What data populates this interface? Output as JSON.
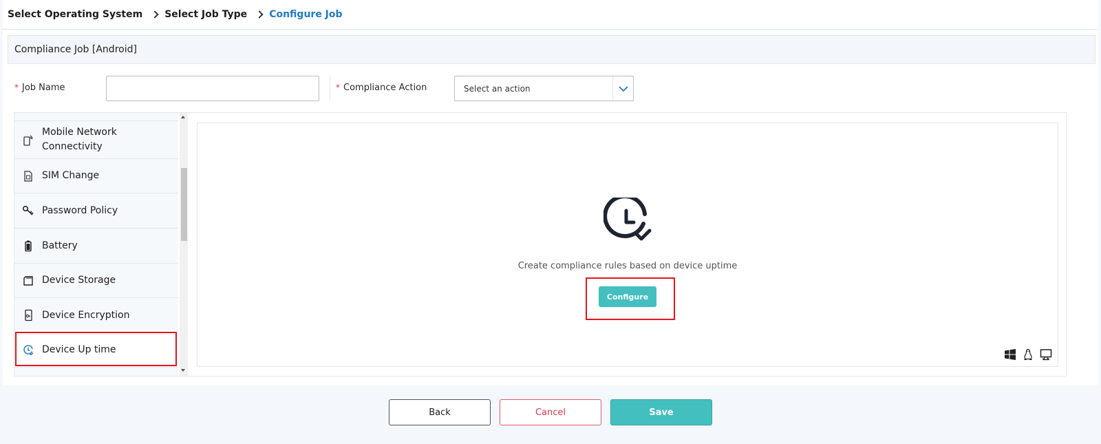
{
  "breadcrumb": {
    "items": [
      "Select Operating System",
      "Select Job Type",
      "Configure Job"
    ]
  },
  "job": {
    "title": "Compliance Job [Android]"
  },
  "form": {
    "job_name_label": "Job Name",
    "job_name_value": "",
    "compliance_action_label": "Compliance Action",
    "compliance_action_value": "Select an action",
    "required_marker": "*"
  },
  "sidebar": {
    "items": [
      {
        "label": "Mobile Network Connectivity",
        "icon": "mobile-network-icon"
      },
      {
        "label": "SIM Change",
        "icon": "sim-card-icon"
      },
      {
        "label": "Password Policy",
        "icon": "key-icon"
      },
      {
        "label": "Battery",
        "icon": "battery-icon"
      },
      {
        "label": "Device Storage",
        "icon": "storage-card-icon"
      },
      {
        "label": "Device Encryption",
        "icon": "device-lock-icon"
      },
      {
        "label": "Device Up time",
        "icon": "clock-check-icon",
        "selected": true
      }
    ]
  },
  "main": {
    "icon": "clock-check-icon",
    "description": "Create compliance rules based on device uptime",
    "configure_label": "Configure",
    "platform_icons": [
      "windows-icon",
      "linux-icon",
      "desktop-icon"
    ]
  },
  "footer": {
    "back_label": "Back",
    "cancel_label": "Cancel",
    "save_label": "Save"
  },
  "colors": {
    "accent": "#43bfbf",
    "link": "#1f7bc6",
    "danger": "#d83a4b",
    "highlight": "#e8141b"
  }
}
